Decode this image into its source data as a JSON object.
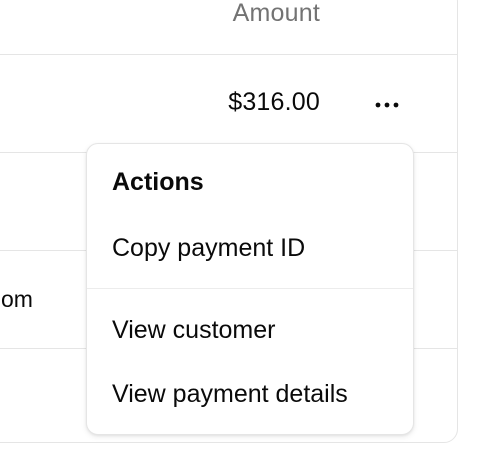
{
  "table": {
    "header": {
      "amount_label": "Amount"
    },
    "rows": [
      {
        "amount": "$316.00",
        "email_fragment": ""
      },
      {
        "amount": "",
        "email_fragment": ""
      },
      {
        "amount": "",
        "email_fragment": "om"
      },
      {
        "amount": "",
        "email_fragment": ""
      }
    ],
    "more_icon": "ellipsis-horizontal-icon"
  },
  "menu": {
    "label": "Actions",
    "items": [
      {
        "label": "Copy payment ID"
      },
      {
        "label": "View customer"
      },
      {
        "label": "View payment details"
      }
    ]
  },
  "colors": {
    "border": "#e5e5e5",
    "muted_text": "#737373",
    "text": "#0a0a0a",
    "background": "#ffffff"
  }
}
